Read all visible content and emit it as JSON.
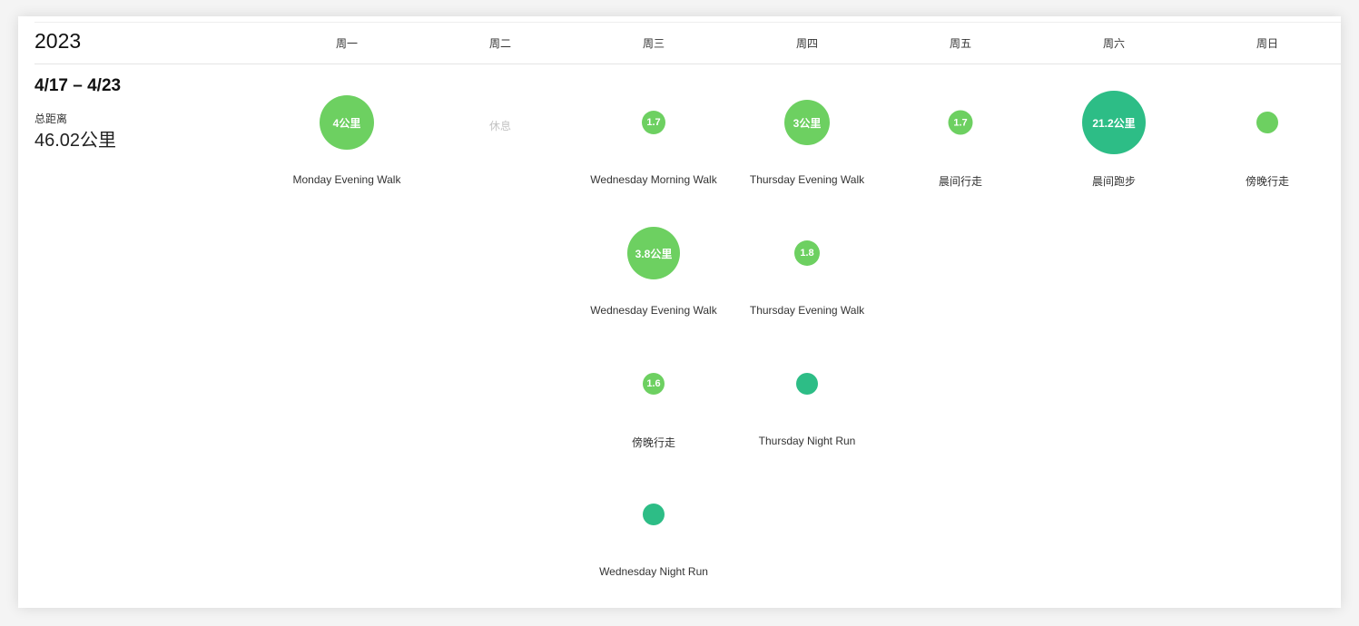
{
  "colors": {
    "walk": "#6dd061",
    "run": "#2dbd86"
  },
  "calendar": {
    "year": "2023",
    "days": [
      "周一",
      "周二",
      "周三",
      "周四",
      "周五",
      "周六",
      "周日"
    ]
  },
  "week": {
    "range": "4/17 – 4/23",
    "total_label": "总距离",
    "total_value": "46.02公里",
    "rest_label": "休息"
  },
  "activities": {
    "mon_0": {
      "label": "4公里",
      "name": "Monday Evening Walk"
    },
    "wed_0": {
      "label": "1.7",
      "name": "Wednesday Morning Walk"
    },
    "wed_1": {
      "label": "3.8公里",
      "name": "Wednesday Evening Walk"
    },
    "wed_2": {
      "label": "1.6",
      "name": "傍晚行走"
    },
    "wed_3": {
      "label": "",
      "name": "Wednesday Night Run"
    },
    "thu_0": {
      "label": "3公里",
      "name": "Thursday Evening Walk"
    },
    "thu_1": {
      "label": "1.8",
      "name": "Thursday Evening Walk"
    },
    "thu_2": {
      "label": "",
      "name": "Thursday Night Run"
    },
    "fri_0": {
      "label": "1.7",
      "name": "晨间行走"
    },
    "sat_0": {
      "label": "21.2公里",
      "name": "晨间跑步"
    },
    "sun_0": {
      "label": "",
      "name": "傍晚行走"
    }
  }
}
